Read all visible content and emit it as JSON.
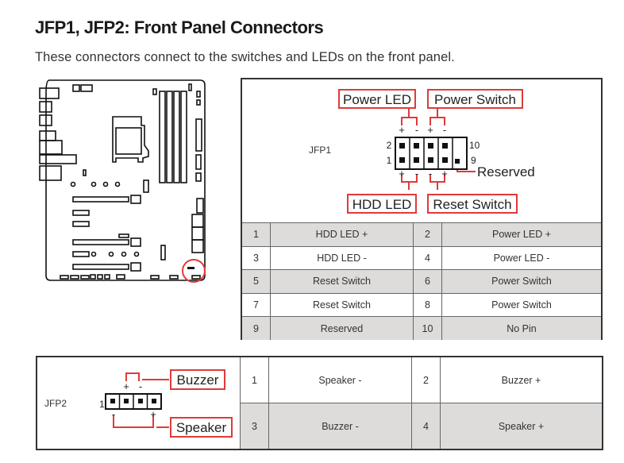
{
  "header": {
    "title": "JFP1, JFP2: Front Panel Connectors",
    "subtitle": "These connectors connect to the switches and LEDs on the front panel."
  },
  "colors": {
    "accent_red": "#e03a3a",
    "table_shade": "#dedcdb",
    "border": "#333333"
  },
  "jfp1": {
    "name": "JFP1",
    "callouts": {
      "power_led": "Power LED",
      "power_switch": "Power Switch",
      "hdd_led": "HDD LED",
      "reset_switch": "Reset Switch",
      "reserved": "Reserved"
    },
    "pin_numbers": {
      "top_left": "2",
      "bottom_left": "1",
      "top_right": "10",
      "bottom_right": "9"
    },
    "top_polarity": [
      "+",
      "-",
      "+",
      "-"
    ],
    "bottom_polarity": [
      "+",
      "-",
      "-",
      "+"
    ],
    "rows": [
      {
        "pin_a": "1",
        "desc_a": "HDD LED +",
        "pin_b": "2",
        "desc_b": "Power LED +"
      },
      {
        "pin_a": "3",
        "desc_a": "HDD LED -",
        "pin_b": "4",
        "desc_b": "Power LED -"
      },
      {
        "pin_a": "5",
        "desc_a": "Reset Switch",
        "pin_b": "6",
        "desc_b": "Power Switch"
      },
      {
        "pin_a": "7",
        "desc_a": "Reset Switch",
        "pin_b": "8",
        "desc_b": "Power Switch"
      },
      {
        "pin_a": "9",
        "desc_a": "Reserved",
        "pin_b": "10",
        "desc_b": "No Pin"
      }
    ]
  },
  "jfp2": {
    "name": "JFP2",
    "pin_one_label": "1",
    "callouts": {
      "buzzer": "Buzzer",
      "speaker": "Speaker"
    },
    "top_polarity": [
      "+",
      "-"
    ],
    "bottom_polarity": [
      "-",
      "+"
    ],
    "rows": [
      {
        "pin_a": "1",
        "desc_a": "Speaker -",
        "pin_b": "2",
        "desc_b": "Buzzer +"
      },
      {
        "pin_a": "3",
        "desc_a": "Buzzer -",
        "pin_b": "4",
        "desc_b": "Speaker +"
      }
    ]
  }
}
